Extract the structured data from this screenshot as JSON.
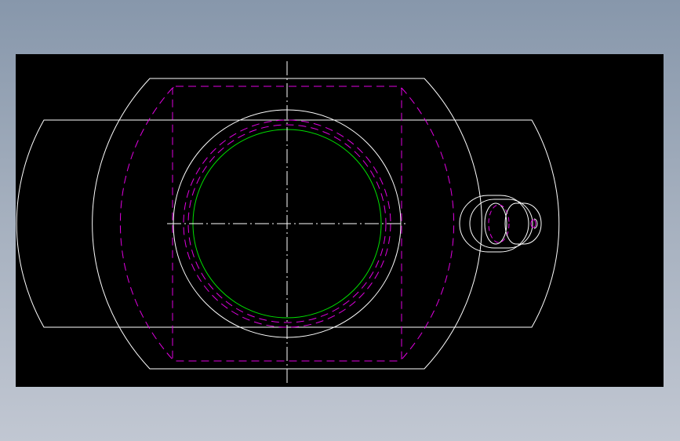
{
  "colors": {
    "background_top": "#8797ab",
    "background_bottom": "#c1c7d2",
    "viewport": "#000000",
    "outline": "#ffffff",
    "hidden_line": "#e000e0",
    "bore": "#00e000",
    "centerline": "#ffffff"
  },
  "view": {
    "line_types": [
      "continuous",
      "dashed",
      "dash-dot"
    ],
    "dashed_color_name": "magenta",
    "bore_color_name": "green"
  }
}
